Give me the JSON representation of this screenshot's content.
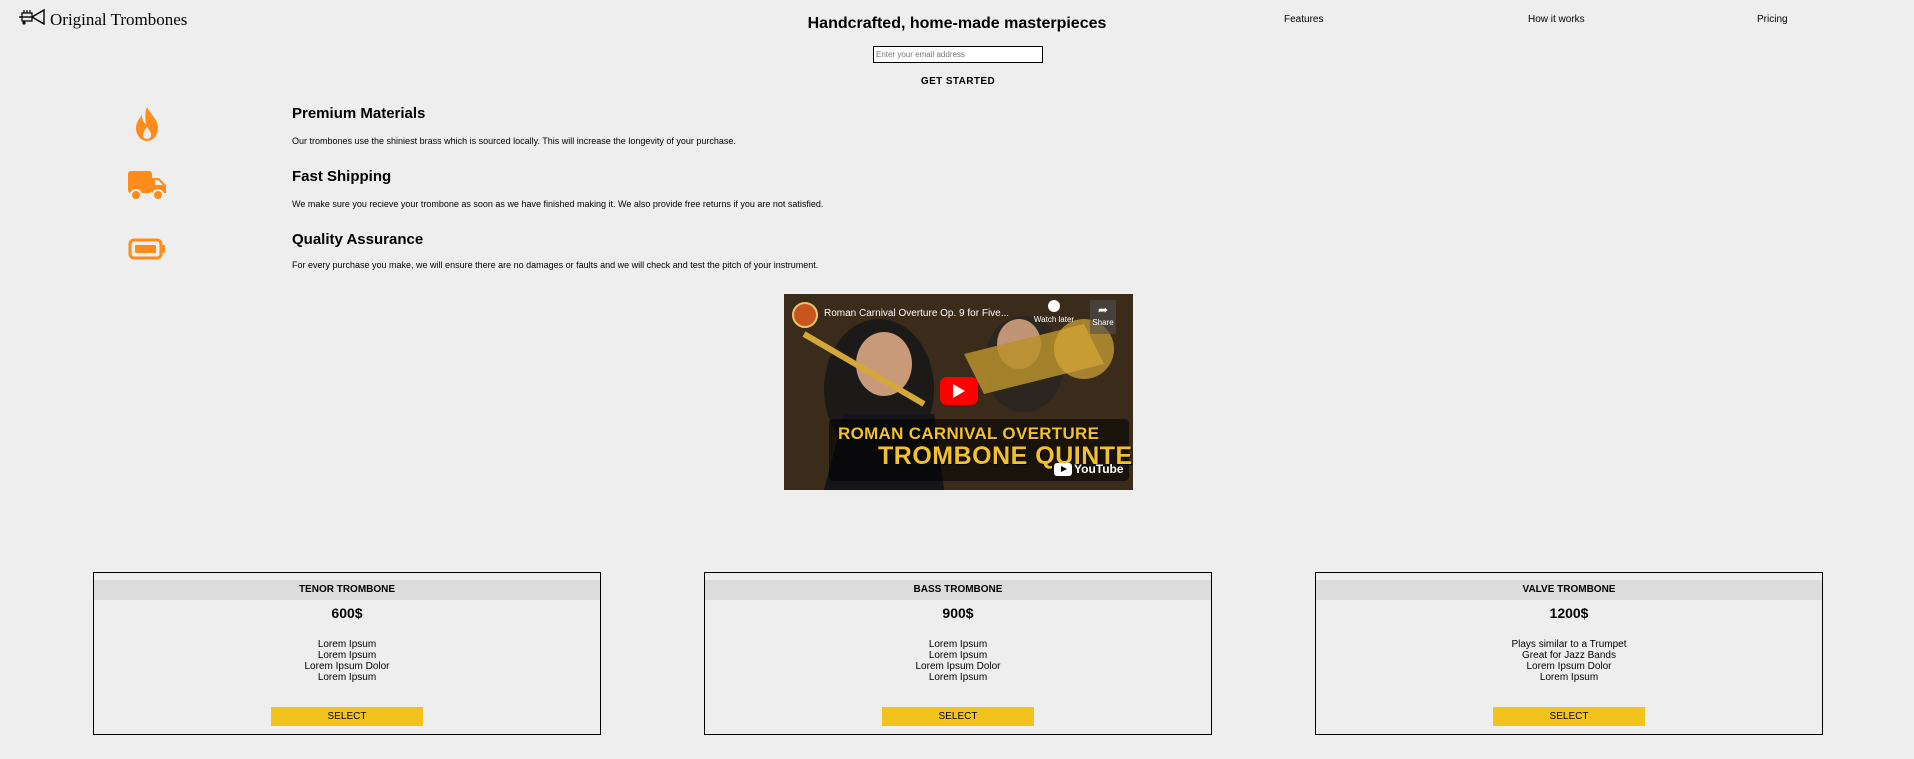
{
  "colors": {
    "accent": "#ff8c1a",
    "button": "#f2c31d",
    "background": "#eeeeee",
    "plan_header": "#dcdcdc"
  },
  "header": {
    "logo_icon": "trumpet-icon",
    "logo_text": "Original Trombones",
    "headline": "Handcrafted, home-made masterpieces",
    "email_placeholder": "Enter your email address",
    "cta": "GET STARTED",
    "nav": [
      "Features",
      "How it works",
      "Pricing"
    ]
  },
  "features": [
    {
      "icon": "fire-icon",
      "title": "Premium Materials",
      "desc": "Our trombones use the shiniest brass which is sourced locally. This will increase the longevity of your purchase."
    },
    {
      "icon": "truck-icon",
      "title": "Fast Shipping",
      "desc": "We make sure you recieve your trombone as soon as we have finished making it. We also provide free returns if you are not satisfied."
    },
    {
      "icon": "battery-icon",
      "title": "Quality Assurance",
      "desc": "For every purchase you make, we will ensure there are no damages or faults and we will check and test the pitch of your instrument."
    }
  ],
  "video": {
    "title": "Roman Carnival Overture Op. 9 for Five...",
    "watch_later": "Watch later",
    "share": "Share",
    "caption_line1": "ROMAN CARNIVAL OVERTURE",
    "caption_line2": "TROMBONE QUINTET",
    "brand": "YouTube"
  },
  "plans": [
    {
      "name": "TENOR TROMBONE",
      "price": "600$",
      "features": [
        "Lorem Ipsum",
        "Lorem Ipsum",
        "Lorem Ipsum Dolor",
        "Lorem Ipsum"
      ],
      "button": "SELECT"
    },
    {
      "name": "BASS TROMBONE",
      "price": "900$",
      "features": [
        "Lorem Ipsum",
        "Lorem Ipsum",
        "Lorem Ipsum Dolor",
        "Lorem Ipsum"
      ],
      "button": "SELECT"
    },
    {
      "name": "VALVE TROMBONE",
      "price": "1200$",
      "features": [
        "Plays similar to a Trumpet",
        "Great for Jazz Bands",
        "Lorem Ipsum Dolor",
        "Lorem Ipsum"
      ],
      "button": "SELECT"
    }
  ]
}
